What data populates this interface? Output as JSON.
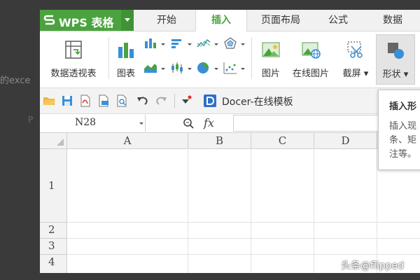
{
  "background": {
    "left_text": "的exce",
    "small_text": "P"
  },
  "app": {
    "name": "WPS 表格",
    "brand_color": "#4aa33e"
  },
  "tabs": [
    {
      "label": "开始",
      "active": false
    },
    {
      "label": "插入",
      "active": true
    },
    {
      "label": "页面布局",
      "active": false
    },
    {
      "label": "公式",
      "active": false
    },
    {
      "label": "数据",
      "active": false
    }
  ],
  "ribbon": {
    "pivot_table": "数据透视表",
    "chart": "图表",
    "picture": "图片",
    "online_picture": "在线图片",
    "screenshot": "截屏",
    "shapes": "形状"
  },
  "doc_tab": {
    "label": "Docer-在线模板",
    "close": "×"
  },
  "formula_bar": {
    "cell_ref": "N28",
    "fx": "fx",
    "value": ""
  },
  "grid": {
    "columns": [
      "A",
      "B",
      "C",
      "D"
    ],
    "rows": [
      "1",
      "2",
      "3",
      "4"
    ]
  },
  "tooltip": {
    "title": "插入形",
    "body": "插入现\n条、矩\n注等。"
  },
  "watermark": "头条@flipped"
}
